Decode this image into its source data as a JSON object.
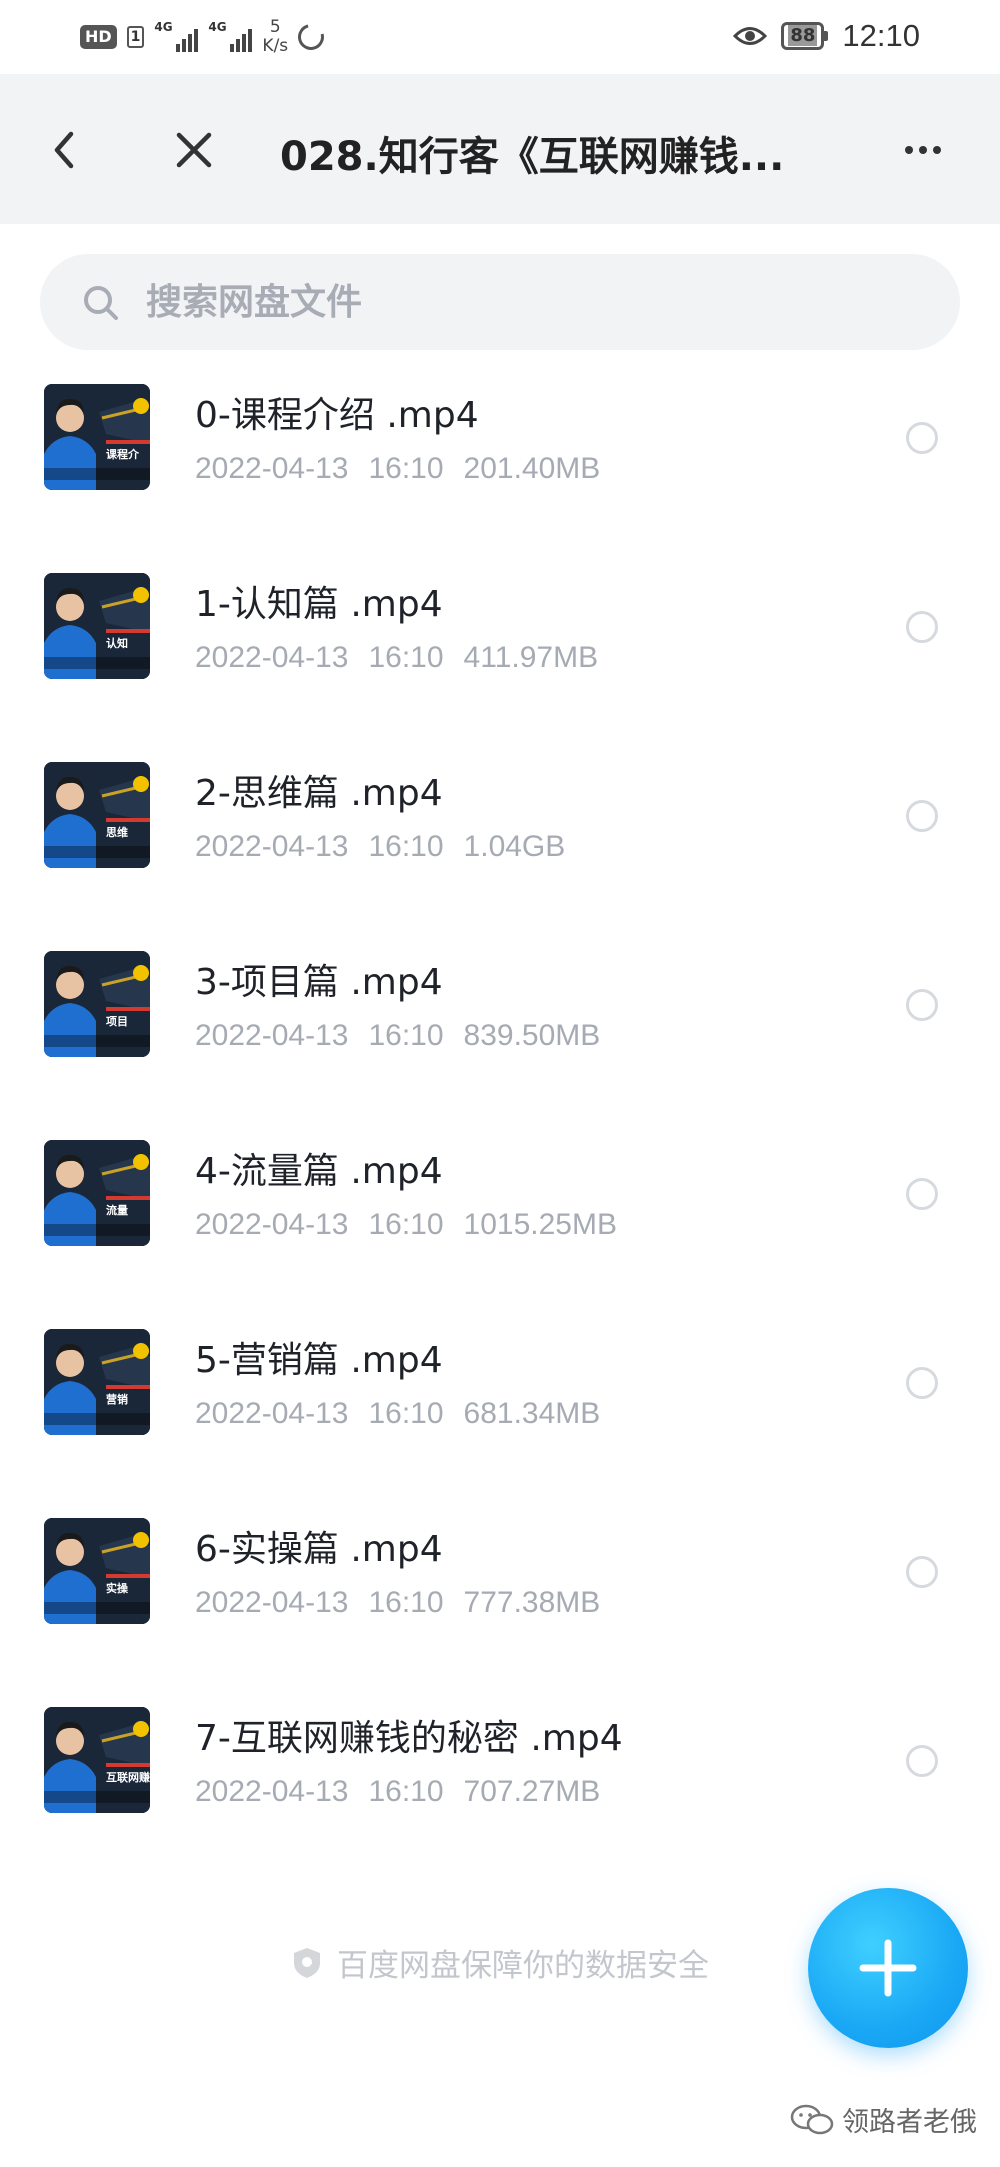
{
  "status_bar": {
    "hd_label": "HD",
    "sim_label": "1",
    "signal1_label": "4G",
    "signal2_label": "4G",
    "speed_value": "5",
    "speed_unit": "K/s",
    "battery": "88",
    "time": "12:10"
  },
  "header": {
    "title": "028.知行客《互联网赚钱...",
    "back_icon": "back-arrow-icon",
    "close_icon": "close-icon",
    "more_icon": "more-icon"
  },
  "search": {
    "placeholder": "搜索网盘文件"
  },
  "files": [
    {
      "name": "0-课程介绍  .mp4",
      "date": "2022-04-13",
      "time": "16:10",
      "size": "201.40MB",
      "thumb_caption": "课程介"
    },
    {
      "name": "1-认知篇  .mp4",
      "date": "2022-04-13",
      "time": "16:10",
      "size": "411.97MB",
      "thumb_caption": "认知"
    },
    {
      "name": "2-思维篇  .mp4",
      "date": "2022-04-13",
      "time": "16:10",
      "size": "1.04GB",
      "thumb_caption": "思维"
    },
    {
      "name": "3-项目篇  .mp4",
      "date": "2022-04-13",
      "time": "16:10",
      "size": "839.50MB",
      "thumb_caption": "项目"
    },
    {
      "name": "4-流量篇  .mp4",
      "date": "2022-04-13",
      "time": "16:10",
      "size": "1015.25MB",
      "thumb_caption": "流量"
    },
    {
      "name": "5-营销篇  .mp4",
      "date": "2022-04-13",
      "time": "16:10",
      "size": "681.34MB",
      "thumb_caption": "营销"
    },
    {
      "name": "6-实操篇  .mp4",
      "date": "2022-04-13",
      "time": "16:10",
      "size": "777.38MB",
      "thumb_caption": "实操"
    },
    {
      "name": "7-互联网赚钱的秘密  .mp4",
      "date": "2022-04-13",
      "time": "16:10",
      "size": "707.27MB",
      "thumb_caption": "互联网赚"
    }
  ],
  "footer": {
    "note": "百度网盘保障你的数据安全",
    "shield_icon": "shield-icon"
  },
  "fab": {
    "icon": "plus-icon"
  },
  "watermark": {
    "text": "领路者老俄"
  },
  "colors": {
    "accent": "#1aa8f5",
    "header_bg": "#f2f3f5",
    "meta_text": "#a6abb3",
    "thumb_bg": "#1a2738",
    "thumb_figure": "#1f6fd1"
  }
}
